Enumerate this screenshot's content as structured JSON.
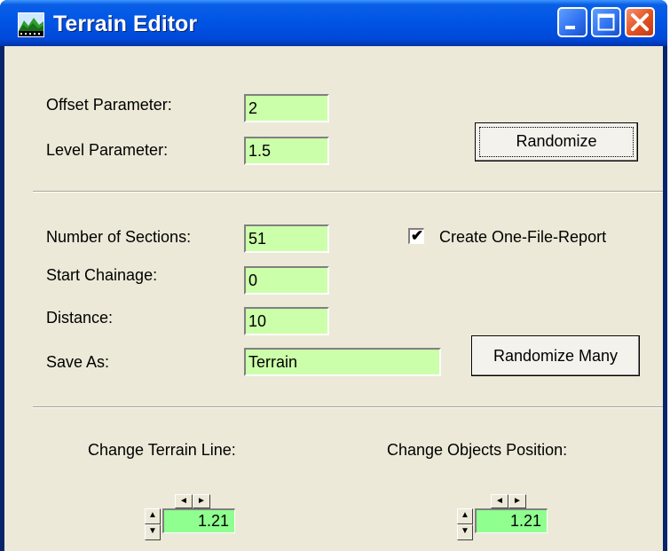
{
  "window": {
    "title": "Terrain Editor"
  },
  "form": {
    "offset": {
      "label": "Offset Parameter:",
      "value": "2"
    },
    "level": {
      "label": "Level Parameter:",
      "value": "1.5"
    },
    "randomize_label": "Randomize",
    "sections": {
      "label": "Number of Sections:",
      "value": "51"
    },
    "chainage": {
      "label": "Start Chainage:",
      "value": "0"
    },
    "distance": {
      "label": "Distance:",
      "value": "10"
    },
    "save_as": {
      "label": "Save As:",
      "value": "Terrain"
    },
    "report": {
      "label": "Create One-File-Report",
      "checked": true,
      "mark": "✔"
    },
    "randomize_many_label": "Randomize Many"
  },
  "controls": {
    "terrain_line": {
      "label": "Change Terrain Line:",
      "value": "1.21"
    },
    "objects_position": {
      "label": "Change Objects Position:",
      "value": "1.21"
    },
    "arrows": {
      "left": "◄",
      "right": "►",
      "up": "▲",
      "down": "▼"
    }
  }
}
